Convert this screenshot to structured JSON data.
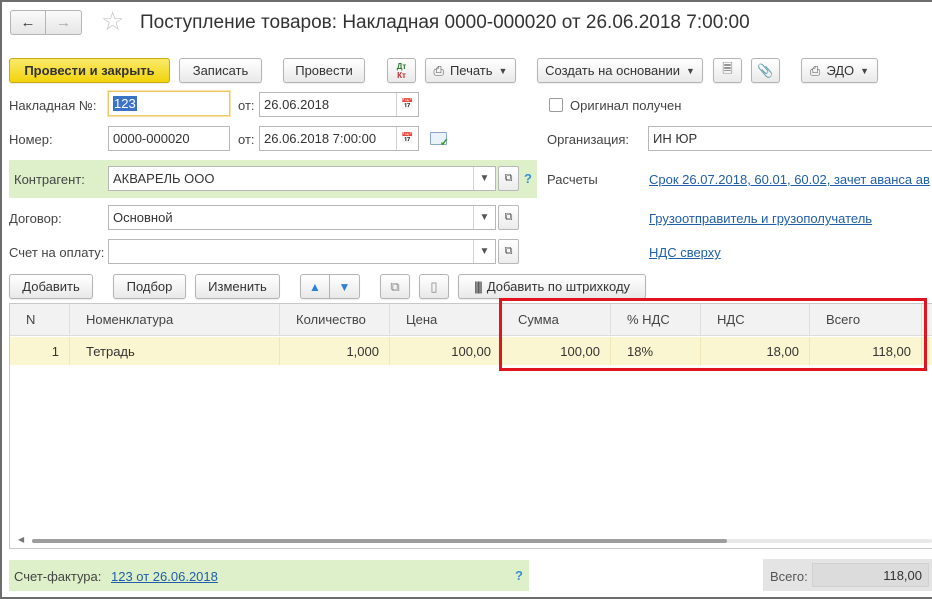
{
  "window": {
    "title": "Поступление товаров: Накладная 0000-000020 от 26.06.2018 7:00:00"
  },
  "toolbar": {
    "post_close": "Провести и закрыть",
    "save": "Записать",
    "post": "Провести",
    "dtkt_top": "Дт",
    "dtkt_bottom": "Кт",
    "print": "Печать",
    "create_based": "Создать на основании",
    "edo": "ЭДО"
  },
  "form": {
    "invoice_no_label": "Накладная №:",
    "invoice_no_value": "123",
    "from_label": "от:",
    "invoice_date": "26.06.2018",
    "original_received_label": "Оригинал получен",
    "number_label": "Номер:",
    "number_value": "0000-000020",
    "from_label2": "от:",
    "doc_datetime": "26.06.2018  7:00:00",
    "org_label": "Организация:",
    "org_value": "ИН ЮР",
    "counterparty_label": "Контрагент:",
    "counterparty_value": "АКВАРЕЛЬ ООО",
    "settlements_label": "Расчеты",
    "settlements_link": "Срок 26.07.2018, 60.01, 60.02, зачет аванса ав",
    "contract_label": "Договор:",
    "contract_value": "Основной",
    "shipper_link": "Грузоотправитель и грузополучатель",
    "invoice_pay_label": "Счет на оплату:",
    "invoice_pay_value": "",
    "vat_link": "НДС сверху",
    "help": "?"
  },
  "table_toolbar": {
    "add": "Добавить",
    "pick": "Подбор",
    "change": "Изменить",
    "barcode": "Добавить по штрихкоду"
  },
  "table": {
    "headers": [
      "N",
      "Номенклатура",
      "Количество",
      "Цена",
      "Сумма",
      "% НДС",
      "НДС",
      "Всего"
    ],
    "rows": [
      [
        "1",
        "Тетрадь",
        "1,000",
        "100,00",
        "100,00",
        "18%",
        "18,00",
        "118,00"
      ]
    ]
  },
  "footer": {
    "sf_label": "Счет-фактура:",
    "sf_link": "123 от 26.06.2018",
    "help": "?",
    "total_label": "Всего:",
    "total_value": "118,00"
  },
  "colors": {
    "primary_button": "#f1d40c",
    "green_highlight": "#ddf0c9",
    "selected_row": "#fbf6d2",
    "link": "#1f5ea8",
    "annotation_box": "#e0141e"
  }
}
